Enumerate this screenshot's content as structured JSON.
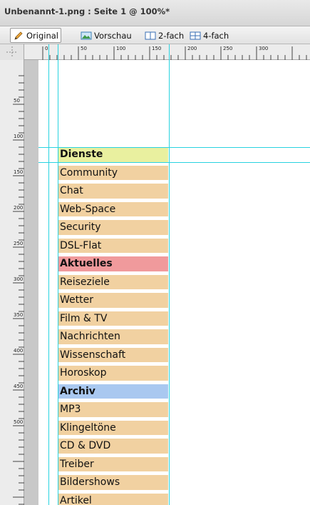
{
  "window": {
    "title": "Unbenannt-1.png : Seite 1 @ 100%*"
  },
  "toolbar": {
    "original": "Original",
    "vorschau": "Vorschau",
    "zweifach": "2-fach",
    "vierfach": "4-fach"
  },
  "ruler": {
    "top_labels": [
      "0",
      "50",
      "100",
      "150",
      "200",
      "250",
      "300"
    ],
    "left_labels": [
      "50",
      "100",
      "150",
      "200",
      "250",
      "300",
      "350",
      "400",
      "450",
      "500"
    ]
  },
  "menu": [
    {
      "label": "Dienste",
      "kind": "header",
      "color": "#e9f09f"
    },
    {
      "label": "Community",
      "kind": "item",
      "color": "#f1d1a1"
    },
    {
      "label": "Chat",
      "kind": "item",
      "color": "#f1d1a1"
    },
    {
      "label": "Web-Space",
      "kind": "item",
      "color": "#f1d1a1"
    },
    {
      "label": "Security",
      "kind": "item",
      "color": "#f1d1a1"
    },
    {
      "label": "DSL-Flat",
      "kind": "item",
      "color": "#f1d1a1"
    },
    {
      "label": "Aktuelles",
      "kind": "header",
      "color": "#f09a9c"
    },
    {
      "label": "Reiseziele",
      "kind": "item",
      "color": "#f1d1a1"
    },
    {
      "label": "Wetter",
      "kind": "item",
      "color": "#f1d1a1"
    },
    {
      "label": "Film & TV",
      "kind": "item",
      "color": "#f1d1a1"
    },
    {
      "label": "Nachrichten",
      "kind": "item",
      "color": "#f1d1a1"
    },
    {
      "label": "Wissenschaft",
      "kind": "item",
      "color": "#f1d1a1"
    },
    {
      "label": "Horoskop",
      "kind": "item",
      "color": "#f1d1a1"
    },
    {
      "label": "Archiv",
      "kind": "header",
      "color": "#a9c8f0"
    },
    {
      "label": "MP3",
      "kind": "item",
      "color": "#f1d1a1"
    },
    {
      "label": "Klingeltöne",
      "kind": "item",
      "color": "#f1d1a1"
    },
    {
      "label": "CD & DVD",
      "kind": "item",
      "color": "#f1d1a1"
    },
    {
      "label": "Treiber",
      "kind": "item",
      "color": "#f1d1a1"
    },
    {
      "label": "Bildershows",
      "kind": "item",
      "color": "#f1d1a1"
    },
    {
      "label": "Artikel",
      "kind": "item",
      "color": "#f1d1a1"
    }
  ],
  "colors": {
    "guide": "#29d3e0"
  }
}
